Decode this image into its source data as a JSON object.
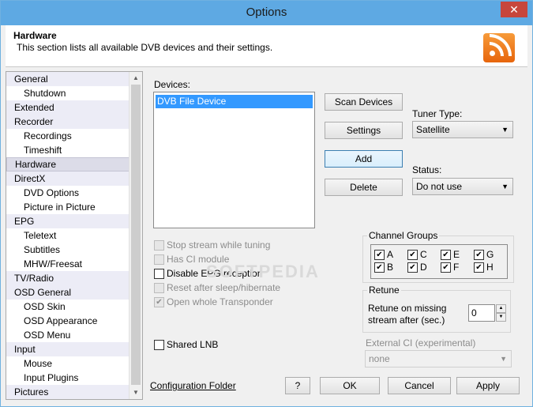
{
  "window": {
    "title": "Options",
    "close_label": "✕"
  },
  "header": {
    "title": "Hardware",
    "description": "This section lists all available DVB devices and their settings."
  },
  "nav": {
    "items": [
      {
        "label": "General"
      },
      {
        "label": "Shutdown"
      },
      {
        "label": "Extended"
      },
      {
        "label": "Recorder"
      },
      {
        "label": "Recordings"
      },
      {
        "label": "Timeshift"
      },
      {
        "label": "Hardware"
      },
      {
        "label": "DirectX"
      },
      {
        "label": "DVD Options"
      },
      {
        "label": "Picture in Picture"
      },
      {
        "label": "EPG"
      },
      {
        "label": "Teletext"
      },
      {
        "label": "Subtitles"
      },
      {
        "label": "MHW/Freesat"
      },
      {
        "label": "TV/Radio"
      },
      {
        "label": "OSD General"
      },
      {
        "label": "OSD Skin"
      },
      {
        "label": "OSD Appearance"
      },
      {
        "label": "OSD Menu"
      },
      {
        "label": "Input"
      },
      {
        "label": "Mouse"
      },
      {
        "label": "Input Plugins"
      },
      {
        "label": "Pictures"
      }
    ]
  },
  "devices": {
    "label": "Devices:",
    "items": [
      "DVB File Device"
    ]
  },
  "buttons": {
    "scan": "Scan Devices",
    "settings": "Settings",
    "add": "Add",
    "delete": "Delete",
    "help": "?",
    "ok": "OK",
    "cancel": "Cancel",
    "apply": "Apply"
  },
  "tuner": {
    "label": "Tuner Type:",
    "value": "Satellite"
  },
  "status": {
    "label": "Status:",
    "value": "Do not use"
  },
  "options": {
    "stop_stream": "Stop stream while tuning",
    "has_ci": "Has CI module",
    "disable_epg": "Disable EPG reception",
    "reset_sleep": "Reset after sleep/hibernate",
    "open_transponder": "Open whole Transponder",
    "shared_lnb": "Shared LNB"
  },
  "channel_groups": {
    "label": "Channel Groups",
    "items": [
      "A",
      "C",
      "E",
      "G",
      "B",
      "D",
      "F",
      "H"
    ]
  },
  "retune": {
    "label": "Retune",
    "line1": "Retune on missing",
    "line2": "stream after (sec.)",
    "value": "0"
  },
  "external_ci": {
    "label": "External CI (experimental)",
    "value": "none"
  },
  "footer": {
    "config_link": "Configuration Folder"
  },
  "watermark": "SOFTPEDIA"
}
